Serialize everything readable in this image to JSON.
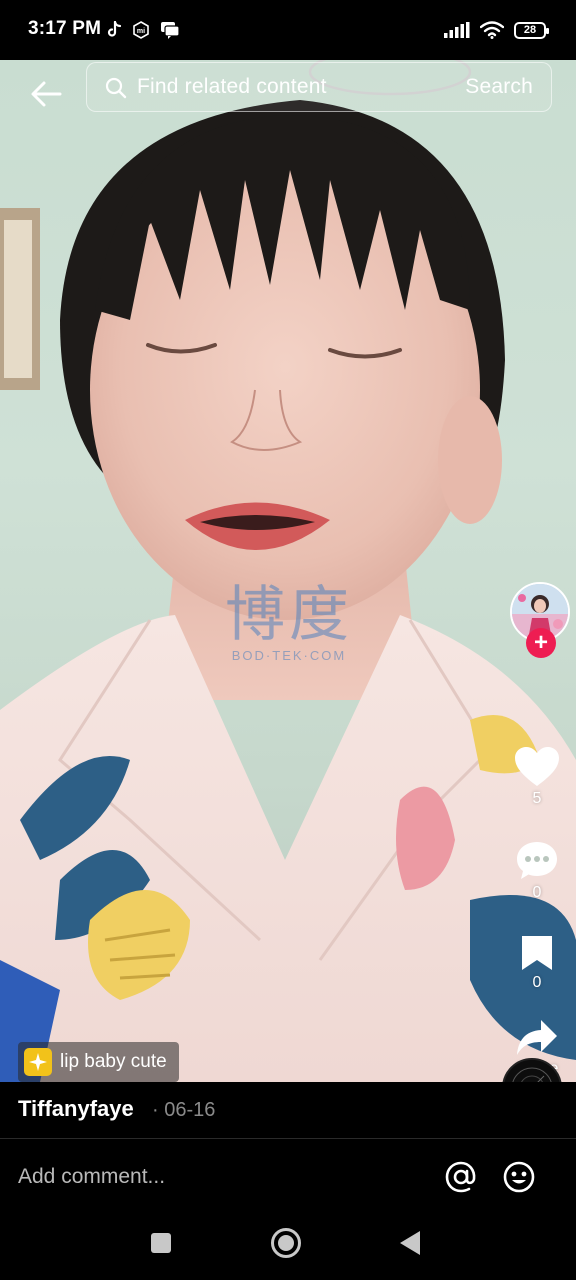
{
  "status_bar": {
    "time": "3:17 PM",
    "battery": "28",
    "left_icons": [
      "tiktok-icon",
      "mi-icon",
      "chat-bubble-icon"
    ],
    "right_icons": [
      "signal-icon",
      "wifi-icon",
      "battery-icon"
    ]
  },
  "search": {
    "placeholder": "Find related content",
    "button_label": "Search"
  },
  "watermark": {
    "main": "博度",
    "sub": "BOD·TEK·COM"
  },
  "rail": {
    "like_count": "5",
    "comment_count": "0",
    "bookmark_count": "0",
    "share_label": "Share"
  },
  "effect": {
    "label": "lip baby cute"
  },
  "author": {
    "name": "Tiffanyfaye",
    "date": "· 06-16"
  },
  "comment": {
    "placeholder": "Add comment..."
  },
  "colors": {
    "accent_red": "#ee1d52",
    "effect_yellow": "#f2c21a",
    "background": "#000000"
  }
}
